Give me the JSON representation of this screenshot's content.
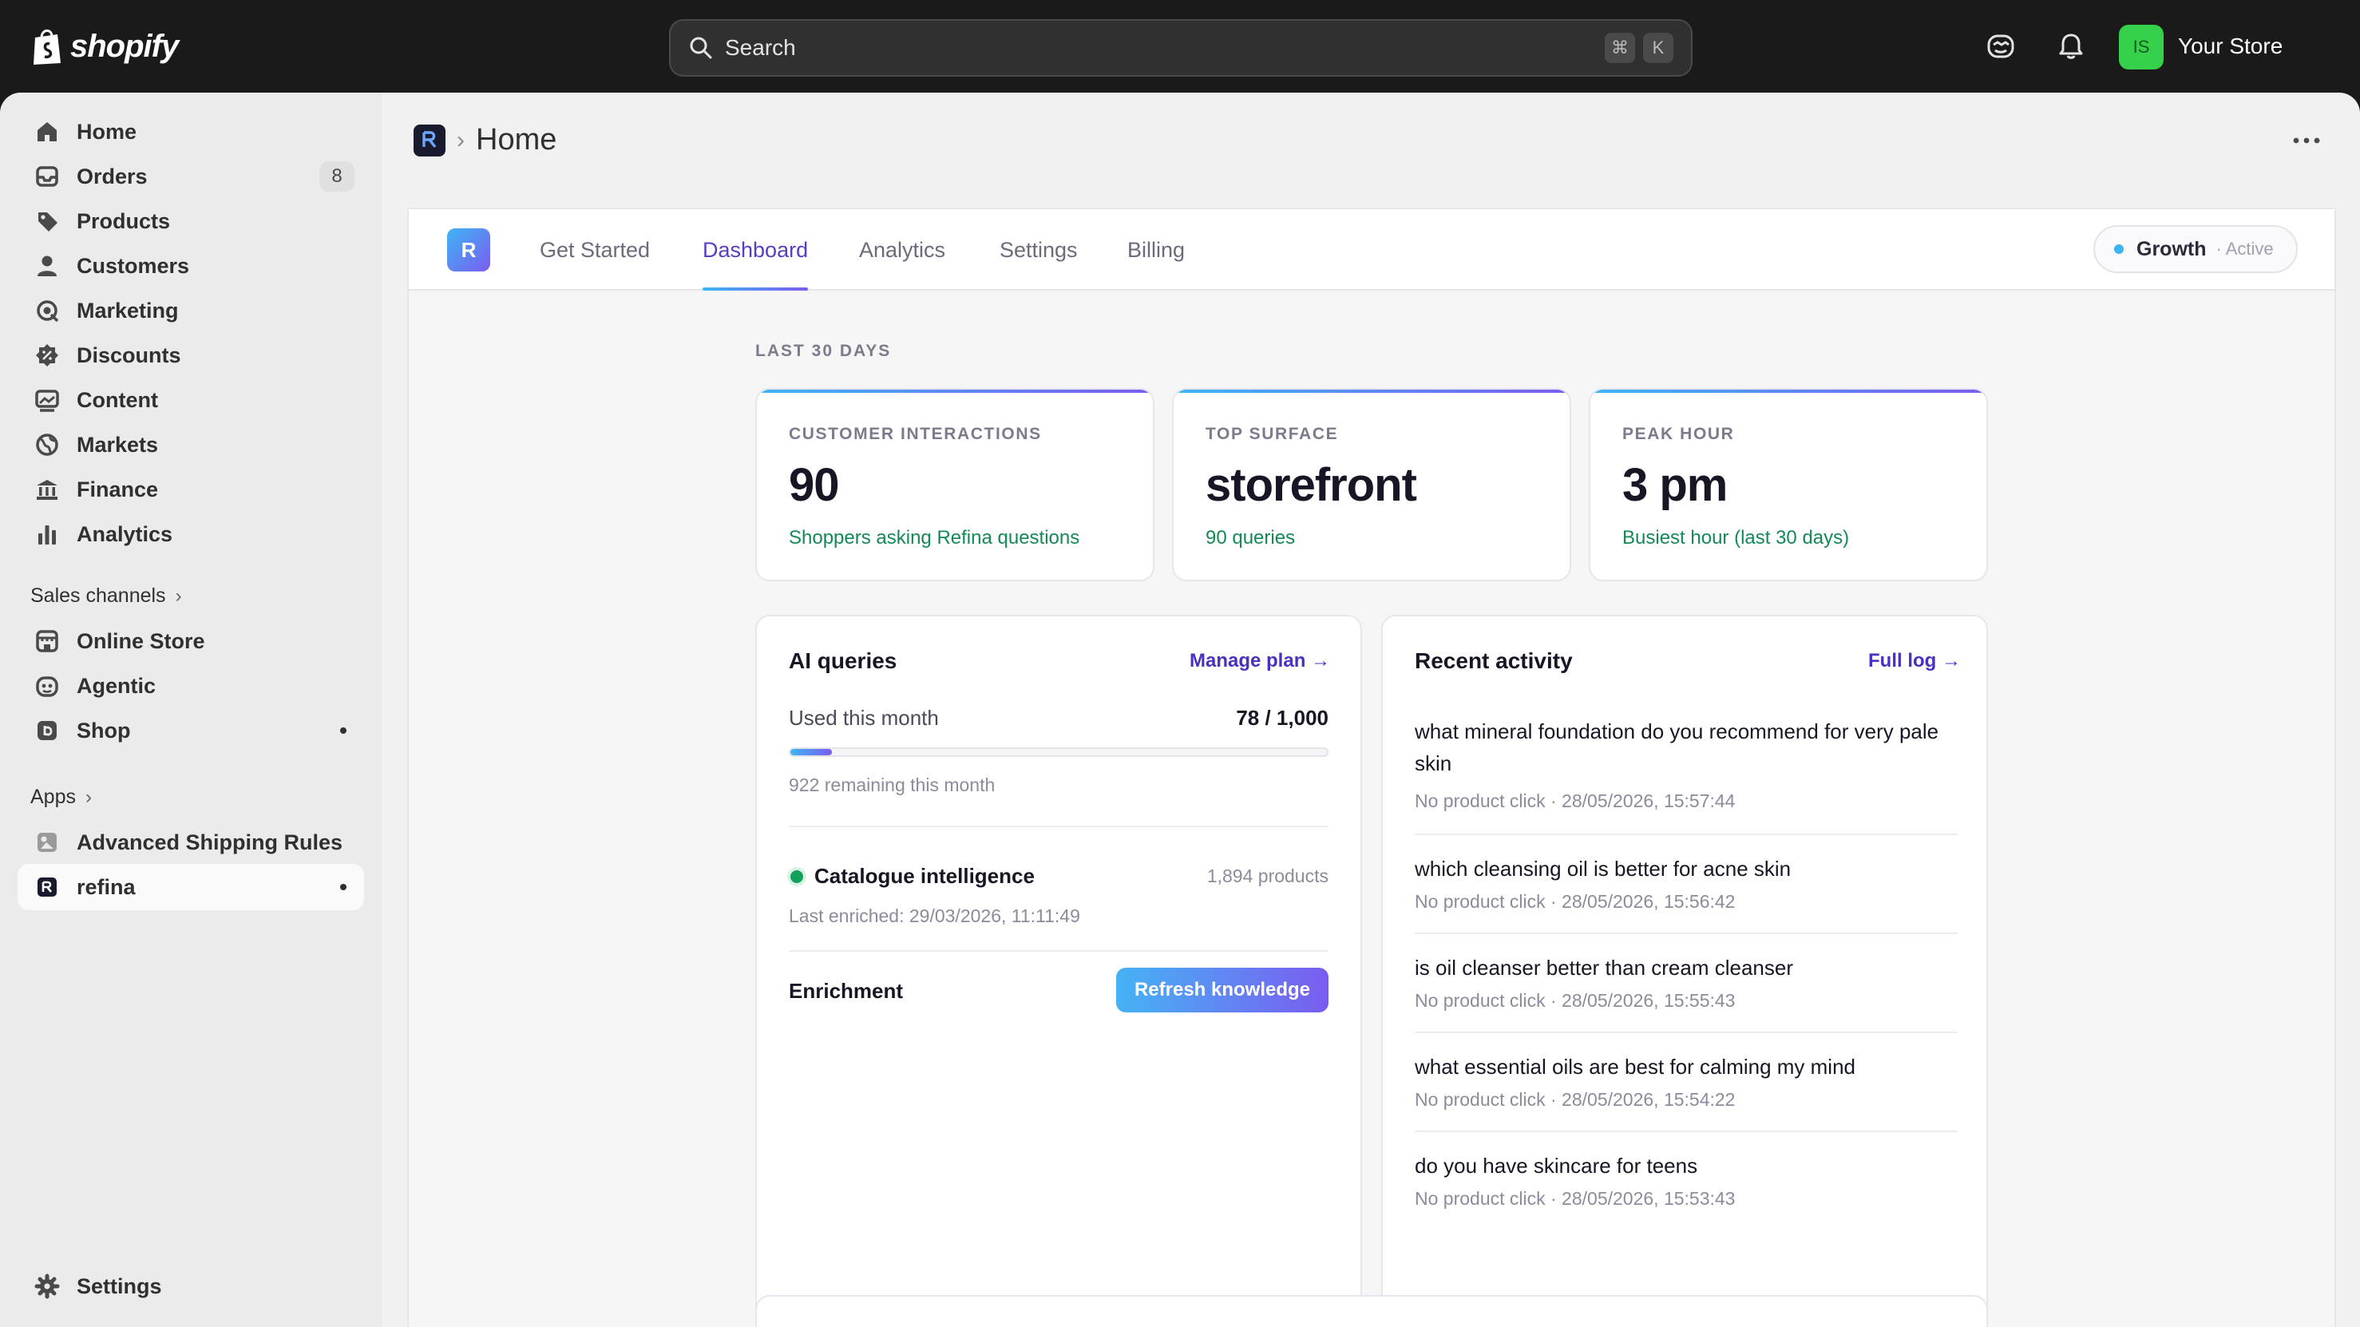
{
  "topbar": {
    "brand": "shopify",
    "search_placeholder": "Search",
    "shortcut_keys": [
      "⌘",
      "K"
    ],
    "store_initials": "IS",
    "store_name": "Your Store",
    "icons": [
      "shopify-bag-icon",
      "search-icon",
      "sidekick-icon",
      "bell-icon"
    ]
  },
  "sidebar": {
    "main": [
      {
        "label": "Home",
        "icon": "home-icon"
      },
      {
        "label": "Orders",
        "icon": "inbox-icon",
        "badge": "8"
      },
      {
        "label": "Products",
        "icon": "tag-icon"
      },
      {
        "label": "Customers",
        "icon": "person-icon"
      },
      {
        "label": "Marketing",
        "icon": "target-icon"
      },
      {
        "label": "Discounts",
        "icon": "discount-icon"
      },
      {
        "label": "Content",
        "icon": "content-icon"
      },
      {
        "label": "Markets",
        "icon": "globe-icon"
      },
      {
        "label": "Finance",
        "icon": "bank-icon"
      },
      {
        "label": "Analytics",
        "icon": "bar-chart-icon"
      }
    ],
    "sales_channels_heading": "Sales channels",
    "sales_channels": [
      {
        "label": "Online Store",
        "icon": "store-icon"
      },
      {
        "label": "Agentic",
        "icon": "agentic-icon"
      },
      {
        "label": "Shop",
        "icon": "shop-icon"
      }
    ],
    "apps_heading": "Apps",
    "apps": [
      {
        "label": "Advanced Shipping Rules",
        "icon": "app-tile-icon"
      },
      {
        "label": "refina",
        "icon": "refina-icon"
      }
    ],
    "settings_label": "Settings"
  },
  "page": {
    "title": "Home",
    "breadcrumb_separator": "›"
  },
  "app": {
    "logo_letter": "R",
    "tabs": [
      "Get Started",
      "Dashboard",
      "Analytics",
      "Settings",
      "Billing"
    ],
    "active_tab": "Dashboard",
    "plan_name": "Growth",
    "plan_status": "· Active"
  },
  "dashboard": {
    "period_label": "LAST 30 DAYS",
    "stats": [
      {
        "label": "CUSTOMER INTERACTIONS",
        "value": "90",
        "sub": "Shoppers asking Refina questions"
      },
      {
        "label": "TOP SURFACE",
        "value": "storefront",
        "sub": "90 queries"
      },
      {
        "label": "PEAK HOUR",
        "value": "3 pm",
        "sub": "Busiest hour (last 30 days)"
      }
    ],
    "queries": {
      "title": "AI queries",
      "link": "Manage plan →",
      "used_label": "Used this month",
      "used_value": "78 / 1,000",
      "used_fraction": 0.078,
      "remaining": "922 remaining this month",
      "catalogue_label": "Catalogue intelligence",
      "catalogue_count": "1,894 products",
      "last_enriched": "Last enriched: 29/03/2026, 11:11:49",
      "enrichment_label": "Enrichment",
      "refresh_button": "Refresh knowledge"
    },
    "activity": {
      "title": "Recent activity",
      "link": "Full log →",
      "items": [
        {
          "query": "what mineral foundation do you recommend for very pale skin",
          "meta": "No product click · 28/05/2026, 15:57:44"
        },
        {
          "query": "which cleansing oil is better for acne skin",
          "meta": "No product click · 28/05/2026, 15:56:42"
        },
        {
          "query": "is oil cleanser better than cream cleanser",
          "meta": "No product click · 28/05/2026, 15:55:43"
        },
        {
          "query": "what essential oils are best for calming my mind",
          "meta": "No product click · 28/05/2026, 15:54:22"
        },
        {
          "query": "do you have skincare for teens",
          "meta": "No product click · 28/05/2026, 15:53:43"
        }
      ]
    }
  },
  "colors": {
    "accent_blue": "#3db5f5",
    "accent_purple": "#7b5cf0",
    "positive_green": "#138a56",
    "store_avatar": "#36d14a"
  }
}
